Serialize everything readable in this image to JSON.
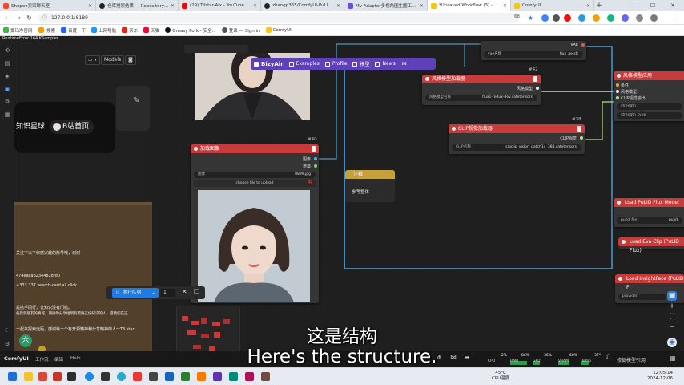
{
  "browser": {
    "tabs": [
      {
        "title": "Shopee卖家聊天室",
        "color": "#ee4d2d"
      },
      {
        "title": "仓库搜索结果 ··· Repository se",
        "color": "#222222"
      },
      {
        "title": "(29) Tilstar-Aix - YouTube",
        "color": "#ff0000"
      },
      {
        "title": "zhangp365/ComfyUI-PuLID-Flu",
        "color": "#222222"
      },
      {
        "title": "Mv Adapter多视角图生图工作流",
        "color": "#6b4fd8"
      },
      {
        "title": "*Unsaved Workflow (3) - Comfy",
        "color": "#f5c518",
        "active": true
      },
      {
        "title": "ComfyUI",
        "color": "#f5c518"
      }
    ],
    "url": "127.0.0.1:8189",
    "zoom_badge": "68",
    "bookmarks": [
      "爱玛净官网",
      "Ⅰ搜索",
      "百度一下",
      "上网导航",
      "京东",
      "天猫",
      "Greasy Fork - 安全...",
      "登录 — Sign in",
      "ComfyUI"
    ]
  },
  "runtime_error": "RuntimeError 164 KSampler",
  "sidebar": {
    "models_label": "Models",
    "promo_buttons": [
      "知识星球",
      "B站首页"
    ],
    "info_lines": [
      "",
      "关注下以下你感兴趣的账号哦，谢谢",
      "",
      "474eacab2344828f80",
      "+333.337.search-card.all.click",
      "",
      "是携手同行，让知识没有门槛。",
      "备受到朋友的真诚，期待你分享给所有需要这份知识的人，愿我们在这",
      "",
      "一起来探索远距，感谢每一个有开源精神和分享精神的人一T8.star"
    ],
    "avatar_char": "六"
  },
  "bizyair": {
    "logo": "BizyAir",
    "items": [
      "Examples",
      "Profile",
      "模型",
      "News"
    ]
  },
  "nodes": {
    "vae": {
      "port": "VAE",
      "widget_label": "vae名称",
      "widget_value": "flux_ae.sft"
    },
    "style_loader": {
      "id": "#42",
      "title": "风格模型加载器",
      "output": "风格模型",
      "widget_label": "风格模型名称",
      "widget_value": "flux1-redux-dev.safetensors"
    },
    "style_apply": {
      "title": "风格模型应用",
      "inputs": [
        "条件",
        "风格模型",
        "CLIP视觉输出"
      ],
      "widgets": [
        "strength",
        "strength_type"
      ]
    },
    "clip_vision": {
      "id": "#38",
      "title": "CLIP视觉加载器",
      "output": "CLIP视觉",
      "widget_label": "CLIP名称",
      "widget_value": "sigclip_vision_patch14_384.safetensors"
    },
    "load_image": {
      "id": "#40",
      "title": "加载图像",
      "outputs": [
        "图像",
        "遮罩"
      ],
      "widget_label": "图像",
      "widget_value": "8899.jpg",
      "upload_label": "choose file to upload"
    },
    "note": {
      "title": "注释",
      "text": "参考整体"
    },
    "pulid_model": {
      "title": "Load PuLID Flux Model",
      "widget_label": "pulid_file",
      "widget_value": "pulid"
    },
    "eva_clip": {
      "title": "Load Eva Clip (PuLID Flux)"
    },
    "insightface": {
      "title": "Load InsightFace (PuLID F",
      "widget_label": "provider"
    }
  },
  "run_bar": {
    "run_label": "执行队列",
    "count": "1"
  },
  "comfy_bar": {
    "brand": "ComfyUI",
    "menu": [
      "工作流",
      "编辑",
      "Help"
    ],
    "meters": [
      {
        "label": "CPU",
        "value": "2%",
        "color": "#3aa0ff",
        "level": 0.02
      },
      {
        "label": "RAM",
        "value": "86%",
        "color": "#2e9e4a",
        "level": 0.86
      },
      {
        "label": "GPU",
        "value": "36%",
        "color": "#2e9e4a",
        "level": 0.36
      },
      {
        "label": "VRAM",
        "value": "60%",
        "color": "#2e9e4a",
        "level": 0.6
      },
      {
        "label": "Temp",
        "value": "37°",
        "color": "#2e9e4a",
        "level": 0.37
      }
    ],
    "extra_button": "修复模型引用"
  },
  "subtitles": {
    "cn": "这是结构",
    "en": "Here's the structure."
  },
  "taskbar": {
    "weather": {
      "temp": "45°C",
      "label": "CPU温度"
    },
    "clock": {
      "time": "12:05:14",
      "date": "2024-12-06"
    }
  }
}
